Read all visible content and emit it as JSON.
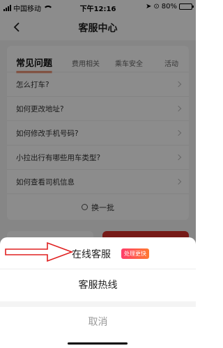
{
  "status_bar": {
    "carrier": "中国移动",
    "time": "下午12:16",
    "battery": "80%",
    "battery_level": 0.8
  },
  "nav": {
    "title": "客服中心"
  },
  "tabs": [
    {
      "label": "常见问题",
      "active": true
    },
    {
      "label": "费用相关",
      "active": false
    },
    {
      "label": "乘车安全",
      "active": false
    },
    {
      "label": "活动",
      "active": false
    }
  ],
  "faq": [
    "怎么打车?",
    "如何更改地址?",
    "如何修改手机号码?",
    "小拉出行有哪些用车类型?",
    "如何查看司机信息"
  ],
  "refresh_label": "换一批",
  "sheet": {
    "online_label": "在线客服",
    "online_badge": "处理更快",
    "hotline_label": "客服热线",
    "cancel_label": "取消"
  },
  "colors": {
    "accent": "#e95b2a",
    "badge_start": "#ff3d6b",
    "badge_end": "#ff7a30",
    "arrow": "#e02020"
  }
}
